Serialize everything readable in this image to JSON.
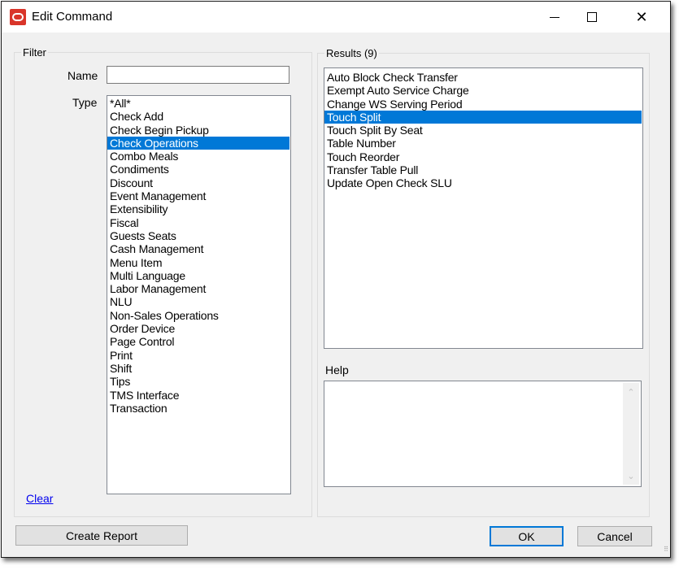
{
  "window": {
    "title": "Edit Command",
    "controls": {
      "minimize": "—",
      "maximize": "☐",
      "close": "✕"
    }
  },
  "filter": {
    "legend": "Filter",
    "name_label": "Name",
    "name_value": "",
    "type_label": "Type",
    "types": [
      "*All*",
      "Check Add",
      "Check Begin Pickup",
      "Check Operations",
      "Combo Meals",
      "Condiments",
      "Discount",
      "Event Management",
      "Extensibility",
      "Fiscal",
      "Guests Seats",
      "Cash Management",
      "Menu Item",
      "Multi Language",
      "Labor Management",
      "NLU",
      "Non-Sales Operations",
      "Order Device",
      "Page Control",
      "Print",
      "Shift",
      "Tips",
      "TMS Interface",
      "Transaction"
    ],
    "selected_type": "Check Operations",
    "clear_link": "Clear"
  },
  "results": {
    "legend": "Results (9)",
    "items": [
      "Auto Block Check Transfer",
      "Exempt Auto Service Charge",
      "Change WS Serving Period",
      "Touch Split",
      "Touch Split By Seat",
      "Table Number",
      "Touch Reorder",
      "Transfer Table Pull",
      "Update Open Check SLU"
    ],
    "selected_item": "Touch Split",
    "help_label": "Help",
    "help_text": "",
    "scroll_up": "⌃",
    "scroll_down": "⌄"
  },
  "buttons": {
    "create_report": "Create Report",
    "ok": "OK",
    "cancel": "Cancel"
  },
  "colors": {
    "selection": "#0078d7",
    "app_icon": "#d9352a",
    "link": "#0000ee"
  }
}
